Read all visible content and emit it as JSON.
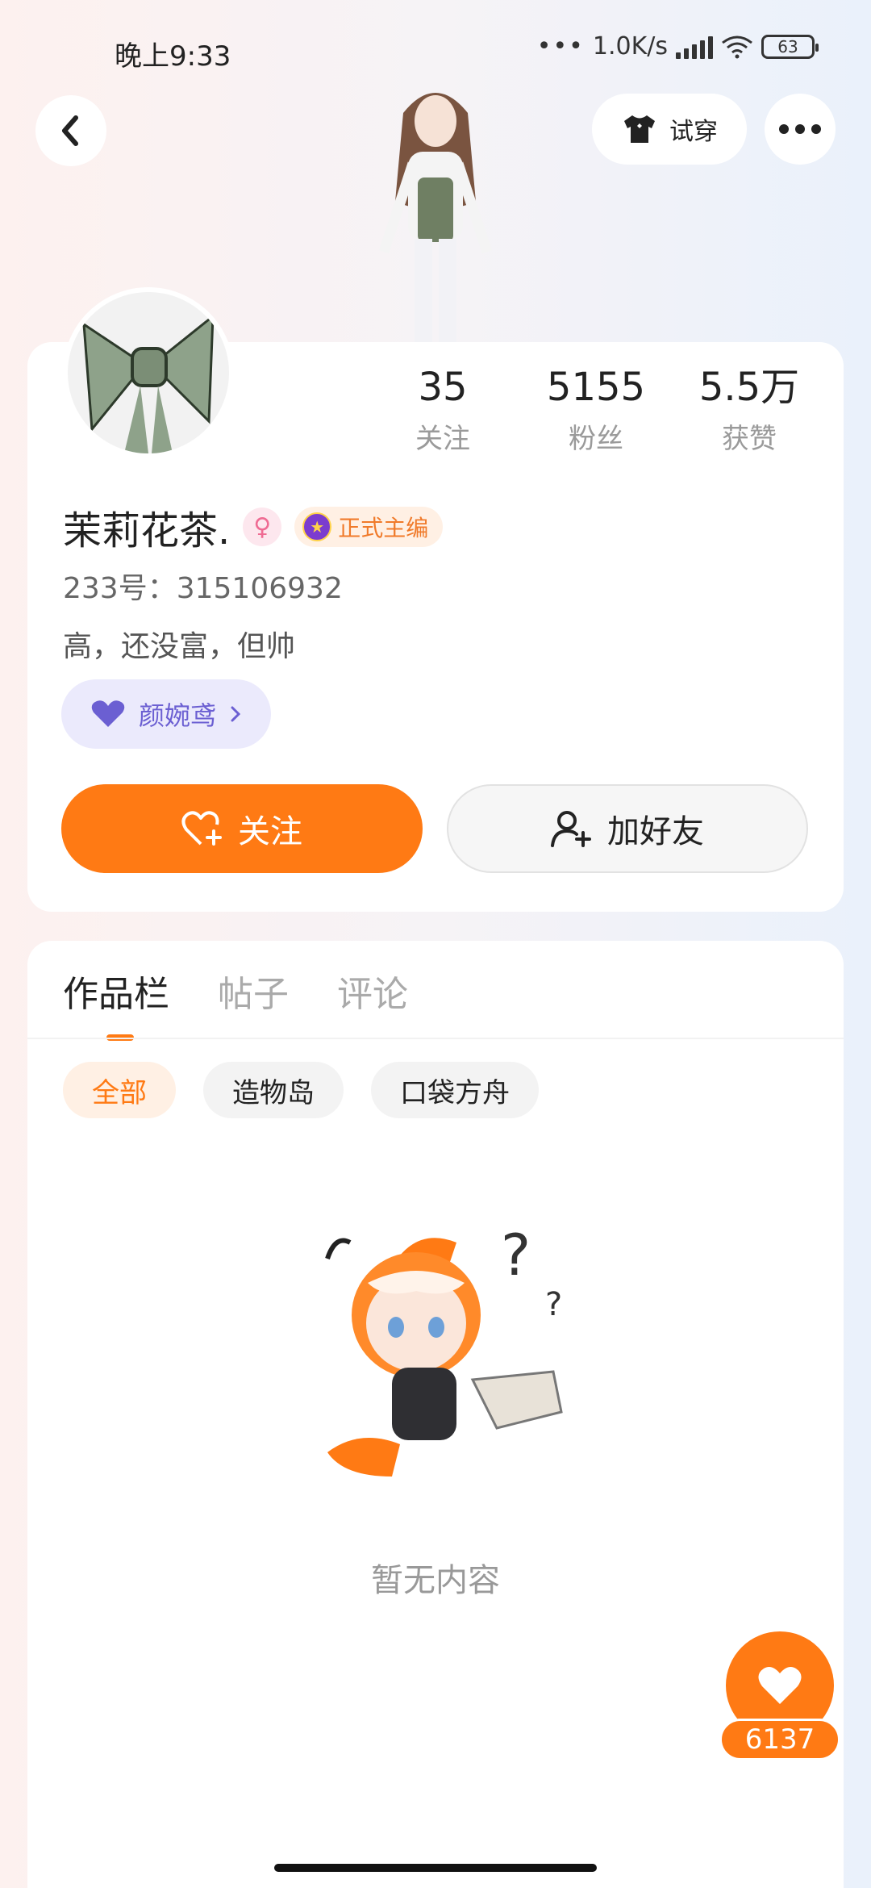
{
  "status_bar": {
    "time": "晚上9:33",
    "network_speed": "1.0K/s",
    "battery": "63"
  },
  "top_nav": {
    "try_on_label": "试穿"
  },
  "profile": {
    "name": "茉莉花茶.",
    "editor_badge": "正式主编",
    "id_text": "233号：315106932",
    "bio": "高，还没富，但帅",
    "companion_name": "颜婉鸢",
    "stats": [
      {
        "value": "35",
        "label": "关注"
      },
      {
        "value": "5155",
        "label": "粉丝"
      },
      {
        "value": "5.5万",
        "label": "获赞"
      }
    ],
    "follow_label": "关注",
    "add_friend_label": "加好友"
  },
  "content": {
    "tabs": [
      {
        "label": "作品栏",
        "active": true
      },
      {
        "label": "帖子",
        "active": false
      },
      {
        "label": "评论",
        "active": false
      }
    ],
    "filters": [
      {
        "label": "全部",
        "active": true
      },
      {
        "label": "造物岛",
        "active": false
      },
      {
        "label": "口袋方舟",
        "active": false
      }
    ],
    "empty_text": "暂无内容"
  },
  "like_fab": {
    "count": "6137"
  },
  "colors": {
    "accent": "#ff7a14",
    "companion": "#6b5fd2",
    "gender": "#ef6b93"
  }
}
